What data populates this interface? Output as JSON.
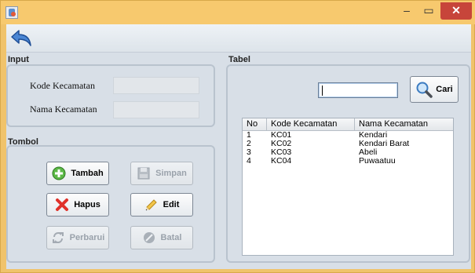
{
  "window": {
    "minimize_glyph": "–",
    "maximize_glyph": "▭",
    "close_glyph": "✕"
  },
  "toolbar": {
    "back_icon": "back-arrow-icon"
  },
  "input": {
    "section_label": "Input",
    "kode_label": "Kode Kecamatan",
    "kode_value": "",
    "nama_label": "Nama Kecamatan",
    "nama_value": ""
  },
  "tombol": {
    "section_label": "Tombol",
    "tambah": "Tambah",
    "simpan": "Simpan",
    "hapus": "Hapus",
    "edit": "Edit",
    "perbarui": "Perbarui",
    "batal": "Batal"
  },
  "tabel": {
    "section_label": "Tabel",
    "search_value": "",
    "search_button": "Cari",
    "columns": [
      "No",
      "Kode Kecamatan",
      "Nama Kecamatan"
    ],
    "rows": [
      [
        "1",
        "KC01",
        "Kendari"
      ],
      [
        "2",
        "KC02",
        "Kendari Barat"
      ],
      [
        "3",
        "KC03",
        "Abeli"
      ],
      [
        "4",
        "KC04",
        "Puwaatuu"
      ]
    ]
  },
  "colors": {
    "title_bar": "#f7c96e",
    "client_bg": "#d8dfe7",
    "close_button": "#c7453a",
    "disabled_text": "#9aa2ab"
  }
}
